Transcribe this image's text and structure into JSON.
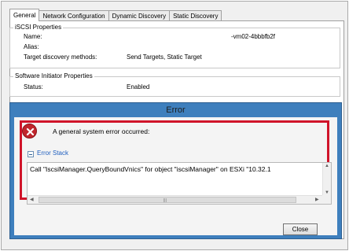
{
  "tabs": [
    "General",
    "Network Configuration",
    "Dynamic Discovery",
    "Static Discovery"
  ],
  "active_tab": "General",
  "iscsi": {
    "title": "iSCSI Properties",
    "name_label": "Name:",
    "name_value": "-vm02-4bbbfb2f",
    "alias_label": "Alias:",
    "alias_value": "",
    "target_label": "Target discovery methods:",
    "target_value": "Send Targets, Static Target"
  },
  "software": {
    "title": "Software Initiator Properties",
    "status_label": "Status:",
    "status_value": "Enabled"
  },
  "error_dialog": {
    "title": "Error",
    "message": "A general system error occurred:",
    "stack_label": "Error Stack",
    "stack_text": "Call \"IscsiManager.QueryBoundVnics\" for object \"iscsiManager\" on ESXi \"10.32.1",
    "close_label": "Close",
    "highlight_color": "#d0142a",
    "title_bar_color": "#3e7fbd"
  }
}
